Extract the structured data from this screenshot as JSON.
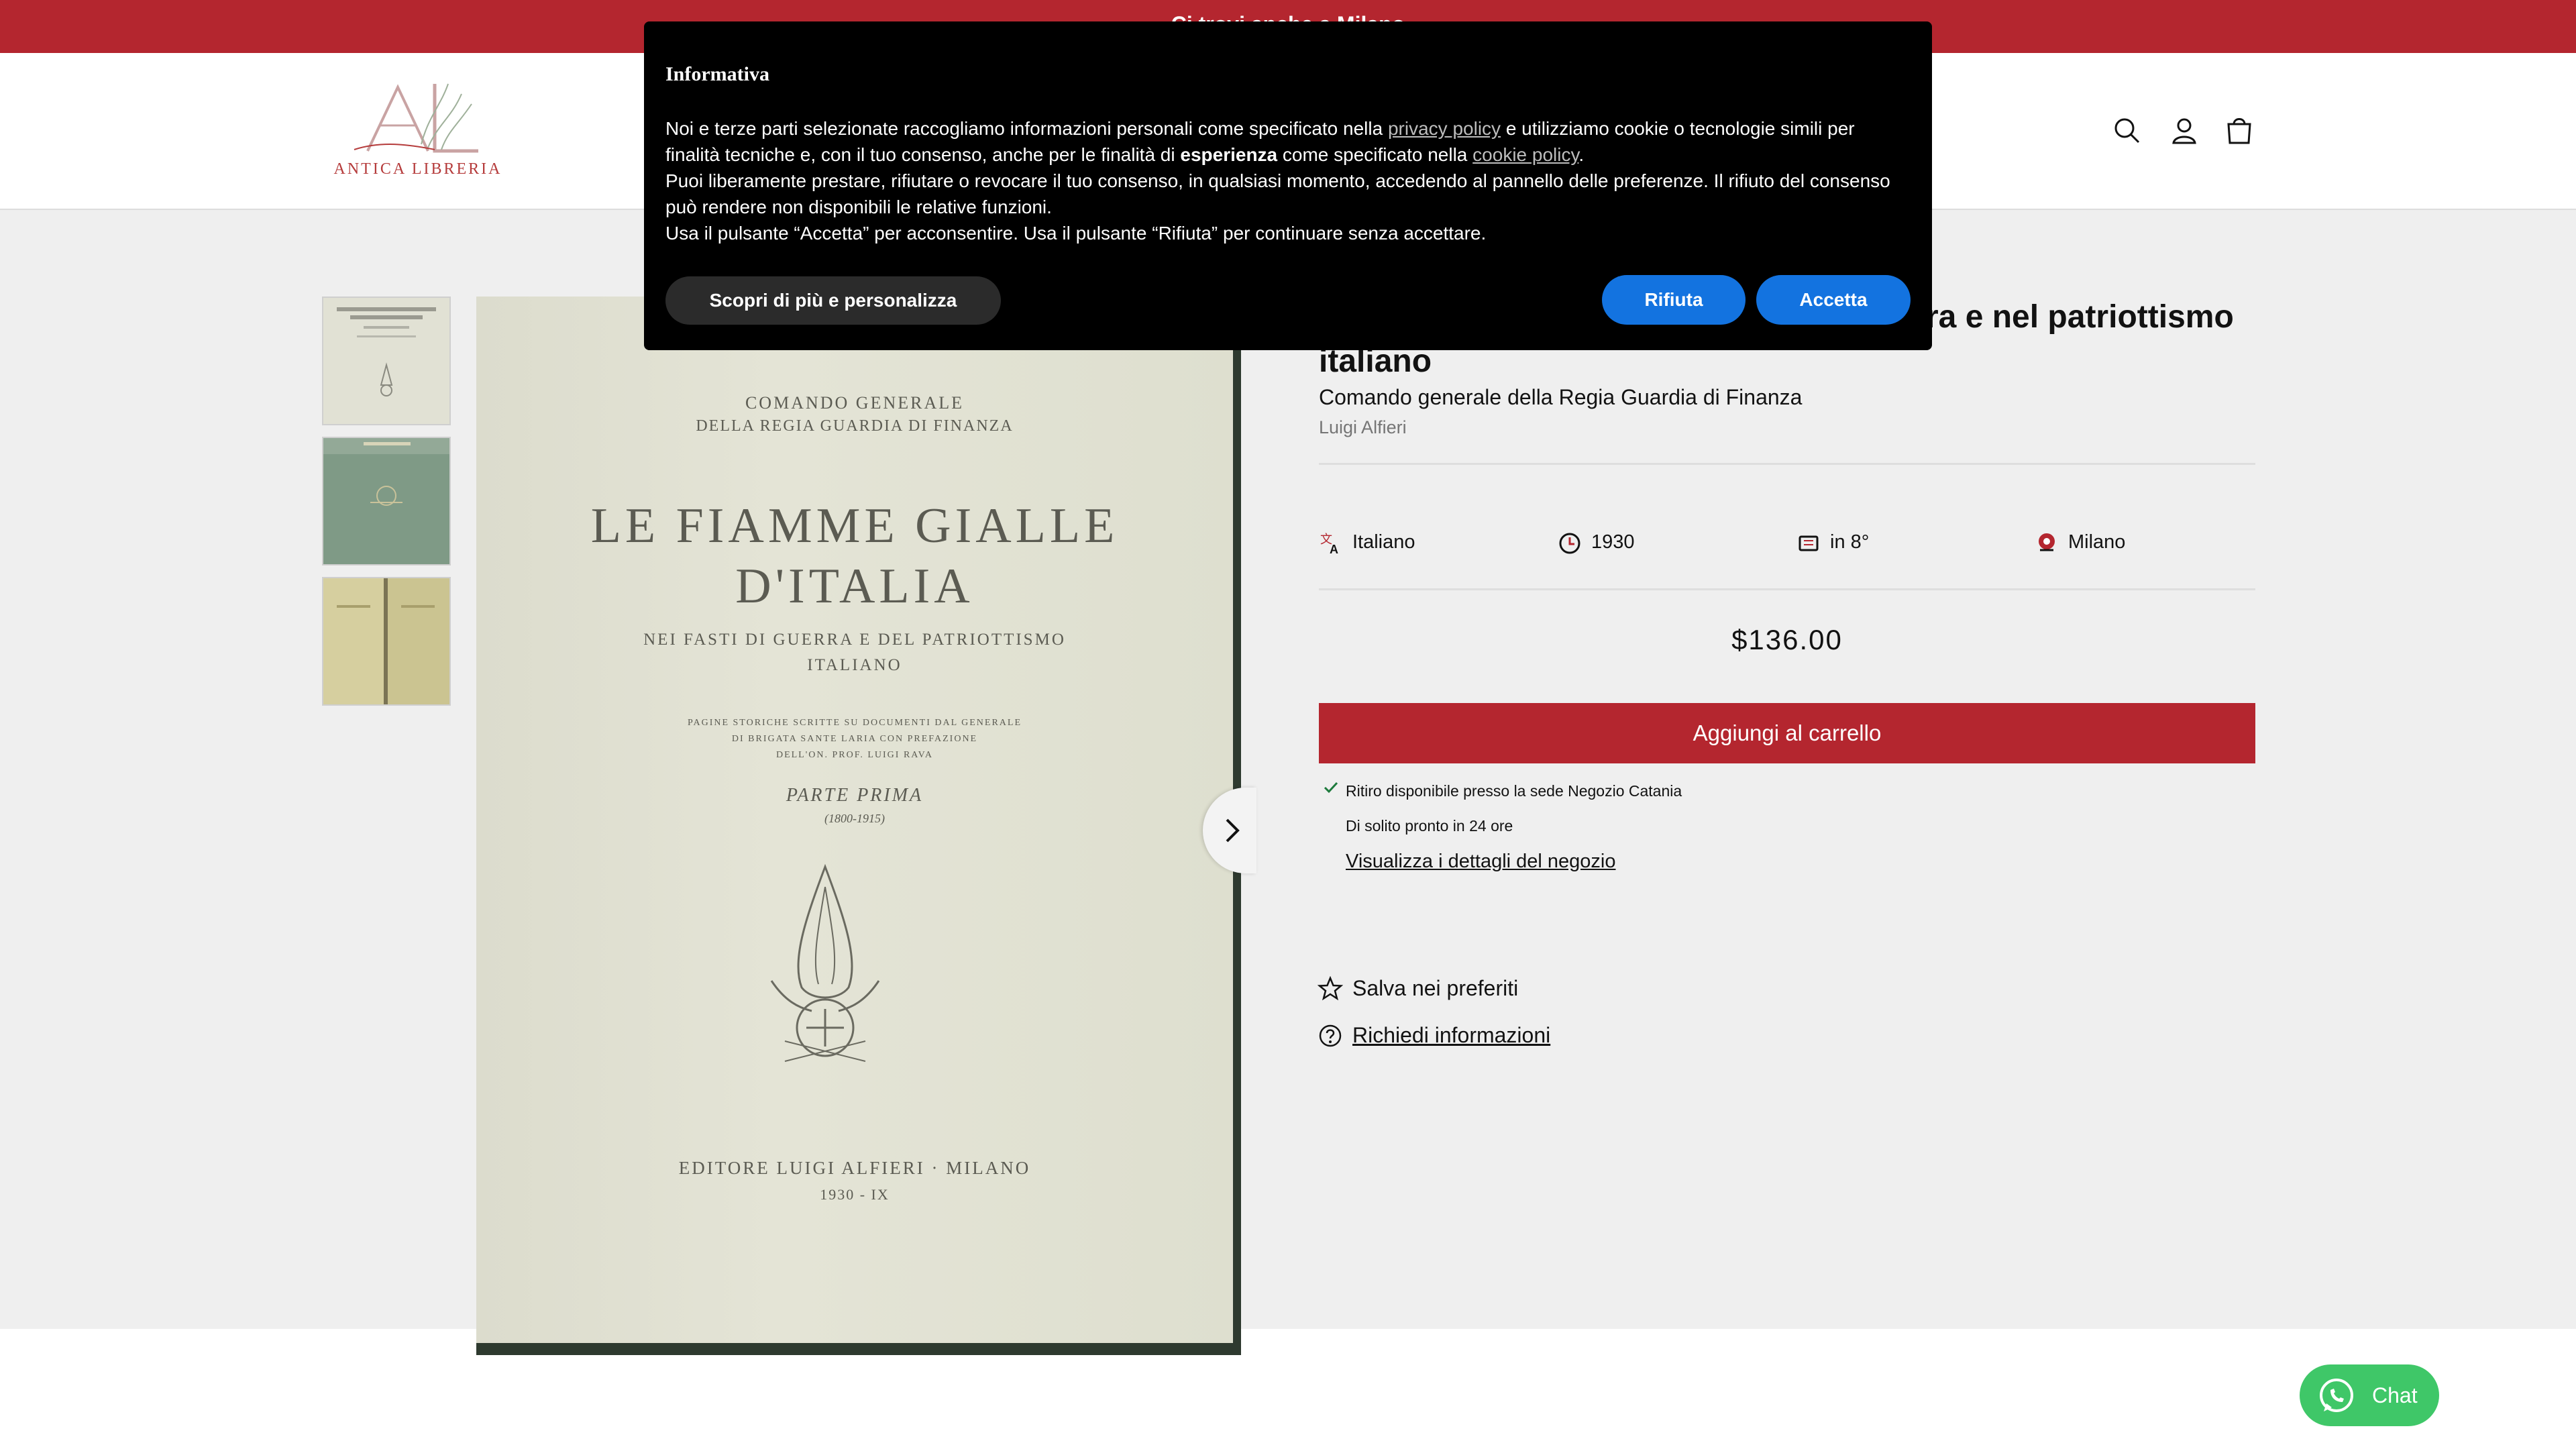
{
  "announcement": {
    "text": "Ci trovi anche a Milano"
  },
  "header": {
    "logo_text": "ANTICA LIBRERIA",
    "icons": [
      "search-icon",
      "account-icon",
      "cart-icon"
    ]
  },
  "gallery": {
    "cover": {
      "top_line1": "COMANDO GENERALE",
      "top_line2": "DELLA REGIA GUARDIA DI FINANZA",
      "title_line1": "LE FIAMME GIALLE",
      "title_line2": "D'ITALIA",
      "sub_line1": "NEI FASTI DI GUERRA E DEL PATRIOTTISMO",
      "sub_line2": "ITALIANO",
      "small_line1": "PAGINE STORICHE SCRITTE SU DOCUMENTI DAL GENERALE",
      "small_line2": "DI BRIGATA SANTE LARIA CON PREFAZIONE",
      "small_line3": "DELL'ON. PROF. LUIGI RAVA",
      "part": "PARTE PRIMA",
      "part_years": "(1800-1915)",
      "publisher": "EDITORE LUIGI ALFIERI · MILANO",
      "year": "1930 - IX"
    }
  },
  "product": {
    "title": "Le fiamme gialle d'Italia nei fasti di guerra e nel patriottismo italiano",
    "subtitle": "Comando generale della Regia Guardia di Finanza",
    "author": "Luigi Alfieri",
    "attributes": [
      {
        "icon": "translate-icon",
        "label": "Italiano"
      },
      {
        "icon": "clock-icon",
        "label": "1930"
      },
      {
        "icon": "book-icon",
        "label": "in 8°"
      },
      {
        "icon": "location-pin-icon",
        "label": "Milano"
      }
    ],
    "price": "$136.00",
    "add_to_cart": "Aggiungi al carrello",
    "pickup": {
      "available": "Ritiro disponibile presso la sede Negozio Catania",
      "ready": "Di solito pronto in 24 ore",
      "details_link": "Visualizza i dettagli del negozio"
    },
    "wishlist": "Salva nei preferiti",
    "request_info": "Richiedi informazioni"
  },
  "cookie_modal": {
    "title": "Informativa",
    "p1_a": "Noi e terze parti selezionate raccogliamo informazioni personali come specificato nella ",
    "privacy_link": "privacy policy",
    "p1_b": " e utilizziamo cookie o tecnologie simili per finalità tecniche e, con il tuo consenso, anche per le finalità di ",
    "p1_bold": "esperienza",
    "p1_c": " come specificato nella ",
    "cookie_link": "cookie policy",
    "p1_d": ".",
    "p2": "Puoi liberamente prestare, rifiutare o revocare il tuo consenso, in qualsiasi momento, accedendo al pannello delle preferenze. Il rifiuto del consenso può rendere non disponibili le relative funzioni.",
    "p3": "Usa il pulsante “Accetta” per acconsentire. Usa il pulsante “Rifiuta” per continuare senza accettare.",
    "btn_more": "Scopri di più e personalizza",
    "btn_reject": "Rifiuta",
    "btn_accept": "Accetta"
  },
  "chat": {
    "label": "Chat"
  },
  "colors": {
    "brand_red": "#b4262f",
    "accept_blue": "#1373e0",
    "chat_green": "#3fc768"
  }
}
